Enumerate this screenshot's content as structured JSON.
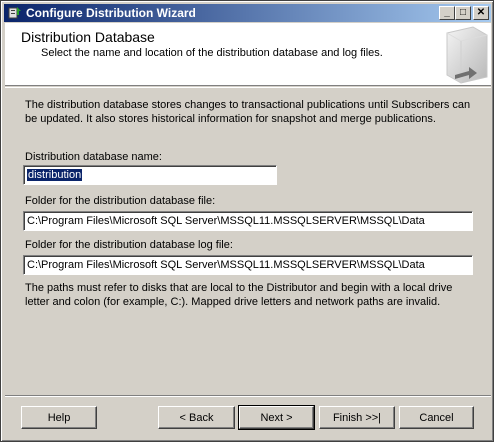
{
  "window": {
    "title": "Configure Distribution Wizard",
    "minimize_glyph": "_",
    "maximize_glyph": "□",
    "close_glyph": "✕"
  },
  "header": {
    "title": "Distribution Database",
    "subtitle": "Select the name and location of the distribution database and log files."
  },
  "body": {
    "description": "The distribution database stores changes to transactional publications until Subscribers can be updated. It also stores historical information for snapshot and merge publications.",
    "db_name_label": "Distribution database name:",
    "db_name_value": "distribution",
    "data_folder_label": "Folder for the distribution database file:",
    "data_folder_value": "C:\\Program Files\\Microsoft SQL Server\\MSSQL11.MSSQLSERVER\\MSSQL\\Data",
    "log_folder_label": "Folder for the distribution database log file:",
    "log_folder_value": "C:\\Program Files\\Microsoft SQL Server\\MSSQL11.MSSQLSERVER\\MSSQL\\Data",
    "note": "The paths must refer to disks that are local to the Distributor and begin with a local drive letter and colon (for example, C:). Mapped drive letters and network paths are invalid."
  },
  "buttons": {
    "help": "Help",
    "back": "< Back",
    "next": "Next >",
    "finish": "Finish >>|",
    "cancel": "Cancel"
  },
  "icons": {
    "app": "wizard-app-icon",
    "header_art": "server-icon"
  }
}
